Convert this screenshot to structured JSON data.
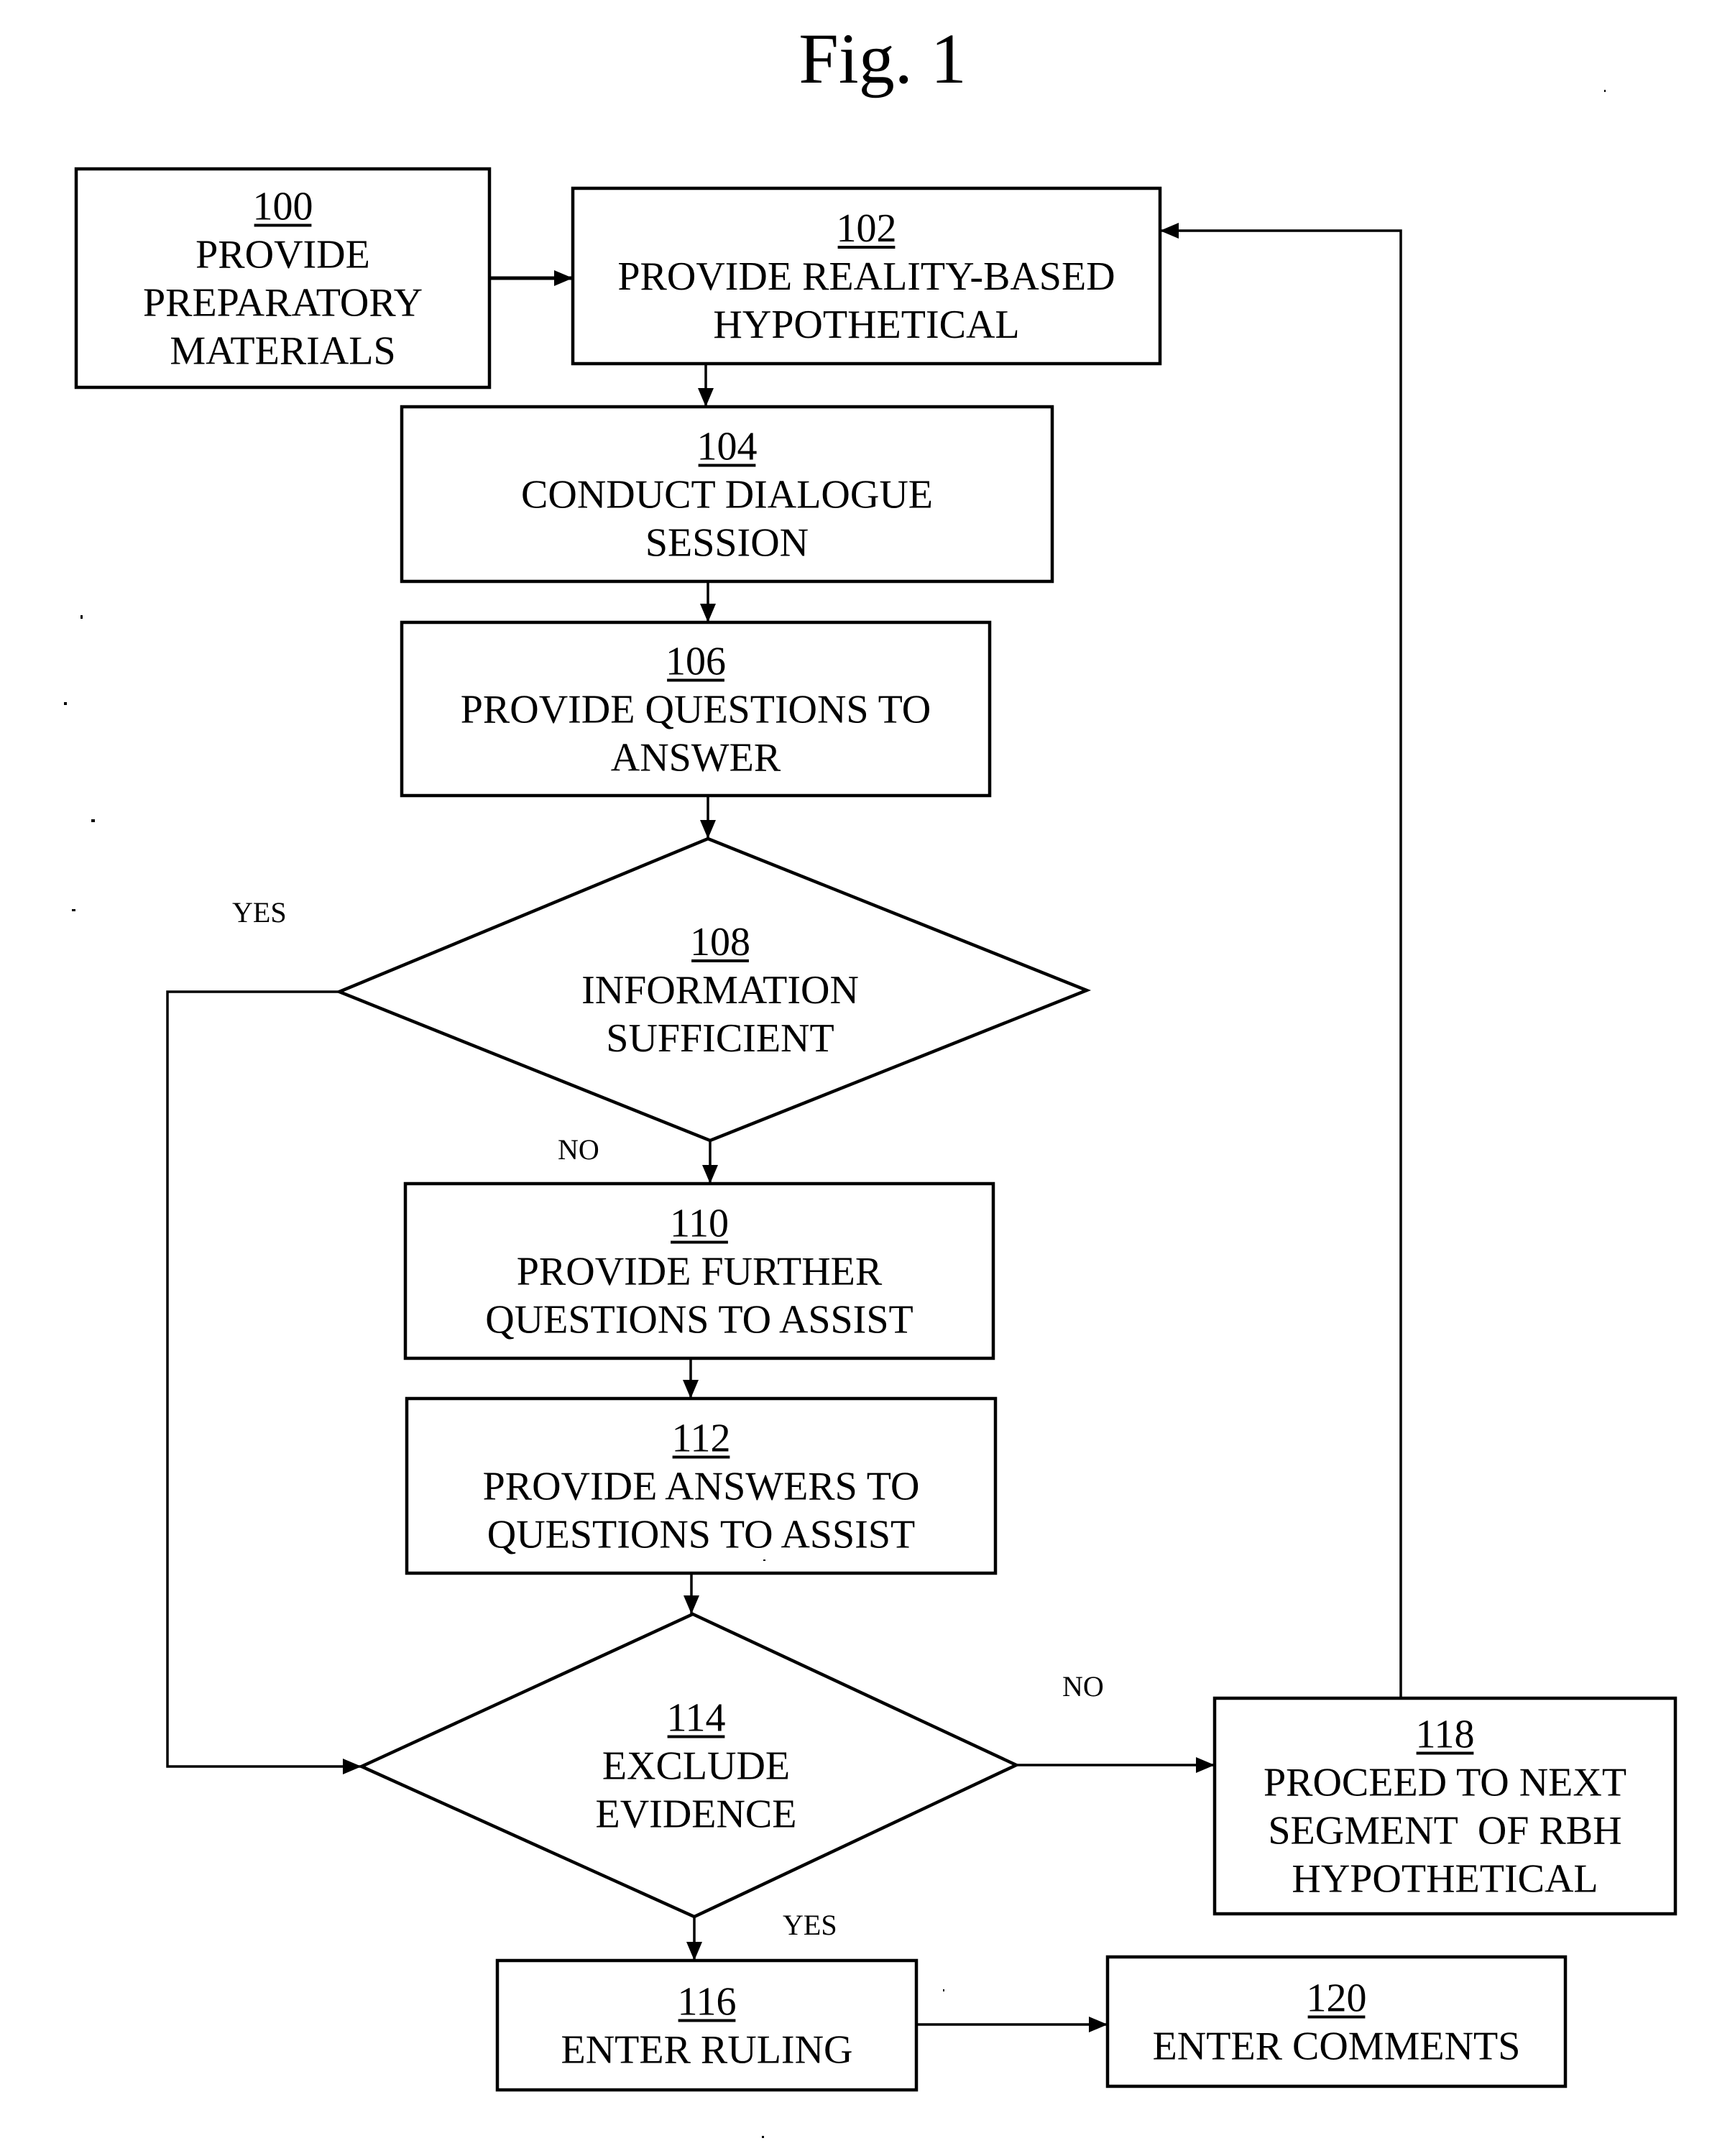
{
  "figure": {
    "title": "Fig. 1",
    "type": "flowchart"
  },
  "nodes": [
    {
      "id": "100",
      "shape": "process",
      "number": "100",
      "lines": [
        "PROVIDE",
        "PREPARATORY",
        "MATERIALS"
      ]
    },
    {
      "id": "102",
      "shape": "process",
      "number": "102",
      "lines": [
        "PROVIDE REALITY-BASED",
        "HYPOTHETICAL"
      ]
    },
    {
      "id": "104",
      "shape": "process",
      "number": "104",
      "lines": [
        "CONDUCT DIALOGUE",
        "SESSION"
      ]
    },
    {
      "id": "106",
      "shape": "process",
      "number": "106",
      "lines": [
        "PROVIDE QUESTIONS TO",
        "ANSWER"
      ]
    },
    {
      "id": "108",
      "shape": "decision",
      "number": "108",
      "lines": [
        "INFORMATION",
        "SUFFICIENT"
      ]
    },
    {
      "id": "110",
      "shape": "process",
      "number": "110",
      "lines": [
        "PROVIDE FURTHER",
        "QUESTIONS TO ASSIST"
      ]
    },
    {
      "id": "112",
      "shape": "process",
      "number": "112",
      "lines": [
        "PROVIDE ANSWERS TO",
        "QUESTIONS TO ASSIST"
      ]
    },
    {
      "id": "114",
      "shape": "decision",
      "number": "114",
      "lines": [
        "EXCLUDE",
        "EVIDENCE"
      ]
    },
    {
      "id": "116",
      "shape": "process",
      "number": "116",
      "lines": [
        "ENTER RULING"
      ]
    },
    {
      "id": "118",
      "shape": "process",
      "number": "118",
      "lines": [
        "PROCEED TO NEXT",
        "SEGMENT  OF RBH",
        "HYPOTHETICAL"
      ]
    },
    {
      "id": "120",
      "shape": "process",
      "number": "120",
      "lines": [
        "ENTER COMMENTS"
      ]
    }
  ],
  "edges": [
    {
      "from": "100",
      "to": "102",
      "label": ""
    },
    {
      "from": "102",
      "to": "104",
      "label": ""
    },
    {
      "from": "104",
      "to": "106",
      "label": ""
    },
    {
      "from": "106",
      "to": "108",
      "label": ""
    },
    {
      "from": "108",
      "to": "114",
      "label": "YES"
    },
    {
      "from": "108",
      "to": "110",
      "label": "NO"
    },
    {
      "from": "110",
      "to": "112",
      "label": ""
    },
    {
      "from": "112",
      "to": "114",
      "label": ""
    },
    {
      "from": "114",
      "to": "118",
      "label": "NO"
    },
    {
      "from": "114",
      "to": "116",
      "label": "YES"
    },
    {
      "from": "118",
      "to": "102",
      "label": ""
    },
    {
      "from": "116",
      "to": "120",
      "label": ""
    }
  ]
}
